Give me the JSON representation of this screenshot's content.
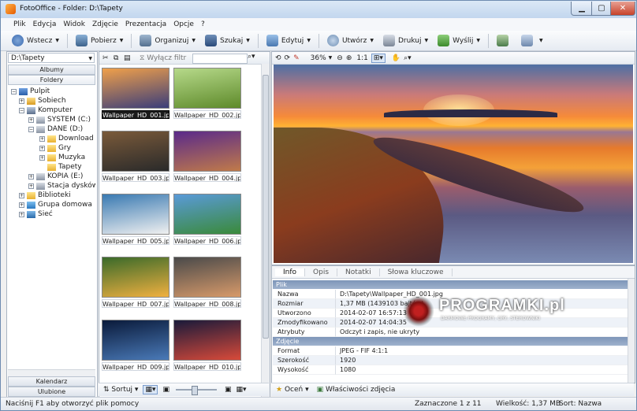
{
  "window": {
    "title": "FotoOffice - Folder: D:\\Tapety"
  },
  "menu": [
    "Plik",
    "Edycja",
    "Widok",
    "Zdjęcie",
    "Prezentacja",
    "Opcje",
    "?"
  ],
  "toolbar": {
    "back": "Wstecz",
    "fetch": "Pobierz",
    "organize": "Organizuj",
    "search": "Szukaj",
    "edit": "Edytuj",
    "create": "Utwórz",
    "print": "Drukuj",
    "send": "Wyślij"
  },
  "left": {
    "path": "D:\\Tapety",
    "tab_albums": "Albumy",
    "tab_folders": "Foldery",
    "tab_calendar": "Kalendarz",
    "tab_favorites": "Ulubione",
    "tree": [
      {
        "label": "Pulpit",
        "exp": "−",
        "icon": "desktop"
      },
      {
        "label": "Sobiech",
        "exp": "+",
        "icon": "user"
      },
      {
        "label": "Komputer",
        "exp": "−",
        "icon": "computer"
      },
      {
        "label": "SYSTEM (C:)",
        "exp": "+",
        "icon": "drive"
      },
      {
        "label": "DANE (D:)",
        "exp": "−",
        "icon": "drive"
      },
      {
        "label": "Download",
        "exp": "+",
        "icon": "folder"
      },
      {
        "label": "Gry",
        "exp": "+",
        "icon": "folder"
      },
      {
        "label": "Muzyka",
        "exp": "+",
        "icon": "folder"
      },
      {
        "label": "Tapety",
        "exp": "",
        "icon": "folder"
      },
      {
        "label": "KOPIA (E:)",
        "exp": "+",
        "icon": "drive"
      },
      {
        "label": "Stacja dysków DV",
        "exp": "+",
        "icon": "drive"
      },
      {
        "label": "Biblioteki",
        "exp": "+",
        "icon": "folder"
      },
      {
        "label": "Grupa domowa",
        "exp": "+",
        "icon": "group"
      },
      {
        "label": "Sieć",
        "exp": "+",
        "icon": "network"
      }
    ]
  },
  "thumbs": {
    "filter_label": "Wyłącz filtr",
    "sort_label": "Sortuj",
    "items": [
      {
        "name": "Wallpaper_HD_001.jpg",
        "c1": "#f0a04a",
        "c2": "#3a3d7a"
      },
      {
        "name": "Wallpaper_HD_002.jpg",
        "c1": "#b6d98a",
        "c2": "#5e8a2a"
      },
      {
        "name": "Wallpaper_HD_003.jpg",
        "c1": "#7a5a3a",
        "c2": "#2a2a2a"
      },
      {
        "name": "Wallpaper_HD_004.jpg",
        "c1": "#5a2a8a",
        "c2": "#c07a4a"
      },
      {
        "name": "Wallpaper_HD_005.jpg",
        "c1": "#3a7ab2",
        "c2": "#f0f0f0"
      },
      {
        "name": "Wallpaper_HD_006.jpg",
        "c1": "#5a9ad8",
        "c2": "#3a8a3a"
      },
      {
        "name": "Wallpaper_HD_007.jpg",
        "c1": "#3a6a2a",
        "c2": "#f0b040"
      },
      {
        "name": "Wallpaper_HD_008.jpg",
        "c1": "#4a4a4a",
        "c2": "#d89a6a"
      },
      {
        "name": "Wallpaper_HD_009.jpg",
        "c1": "#0a1a3a",
        "c2": "#4a7ab8"
      },
      {
        "name": "Wallpaper_HD_010.jpg",
        "c1": "#1a1a3a",
        "c2": "#d84a3a"
      }
    ]
  },
  "preview": {
    "zoom": "36%",
    "ratio": "1:1"
  },
  "info": {
    "tabs": [
      "Info",
      "Opis",
      "Notatki",
      "Słowa kluczowe"
    ],
    "section_file": "Plik",
    "section_photo": "Zdjęcie",
    "file_rows": [
      {
        "k": "Nazwa",
        "v": "D:\\Tapety\\Wallpaper_HD_001.jpg"
      },
      {
        "k": "Rozmiar",
        "v": "1,37 MB  (1439103 bajtów)"
      },
      {
        "k": "Utworzono",
        "v": "2014-02-07 16:57:13"
      },
      {
        "k": "Zmodyfikowano",
        "v": "2014-02-07 14:04:35"
      },
      {
        "k": "Atrybuty",
        "v": "Odczyt i zapis,  nie ukryty"
      }
    ],
    "photo_rows": [
      {
        "k": "Format",
        "v": "JPEG - FIF 4:1:1"
      },
      {
        "k": "Szerokość",
        "v": "1920"
      },
      {
        "k": "Wysokość",
        "v": "1080"
      }
    ],
    "rate_label": "Oceń",
    "props_label": "Właściwości zdjęcia"
  },
  "watermark": {
    "big": "PROGRAMKI.pl",
    "small": "DARMOWE PROGRAMY, GRY, STEROWNIKI"
  },
  "status": {
    "help": "Naciśnij F1 aby otworzyć plik pomocy",
    "selected": "Zaznaczone 1 z 11",
    "size": "Wielkość: 1,37 MB",
    "sort": "Sort: Nazwa"
  }
}
